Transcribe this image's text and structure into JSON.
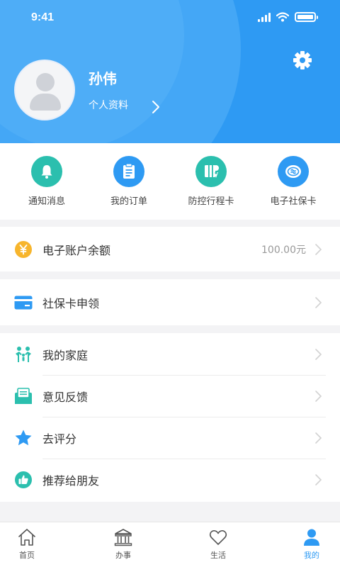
{
  "status_bar": {
    "time": "9:41"
  },
  "header": {
    "username": "孙伟",
    "profile_link": "个人资料",
    "icons": {
      "settings": "gear-icon",
      "avatar": "default-user-avatar"
    }
  },
  "quick_actions": [
    {
      "label": "通知消息",
      "icon": "bell-icon",
      "color": "#2bbfae"
    },
    {
      "label": "我的订单",
      "icon": "order-list-icon",
      "color": "#2e9af3"
    },
    {
      "label": "防控行程卡",
      "icon": "travel-card-icon",
      "color": "#2bbfae"
    },
    {
      "label": "电子社保卡",
      "icon": "social-security-card-icon",
      "color": "#2e9af3"
    }
  ],
  "balance": {
    "label": "电子账户余额",
    "value": "100.00元",
    "icon": "yuan-coin-icon",
    "color": "#f7b52c"
  },
  "apply": {
    "label": "社保卡申领",
    "icon": "card-icon",
    "color": "#2e9af3"
  },
  "menu": [
    {
      "label": "我的家庭",
      "icon": "family-icon",
      "color": "#2bbfae"
    },
    {
      "label": "意见反馈",
      "icon": "feedback-icon",
      "color": "#2bbfae"
    },
    {
      "label": "去评分",
      "icon": "star-icon",
      "color": "#2e9af3"
    },
    {
      "label": "推荐给朋友",
      "icon": "thumbs-up-icon",
      "color": "#2bbfae"
    }
  ],
  "tabs": [
    {
      "label": "首页",
      "icon": "home-icon"
    },
    {
      "label": "办事",
      "icon": "government-building-icon"
    },
    {
      "label": "生活",
      "icon": "heart-icon"
    },
    {
      "label": "我的",
      "icon": "person-icon",
      "active": true
    }
  ],
  "colors": {
    "primary": "#2e9af3",
    "teal": "#2bbfae",
    "gold": "#f7b52c",
    "background": "#f3f3f5"
  }
}
